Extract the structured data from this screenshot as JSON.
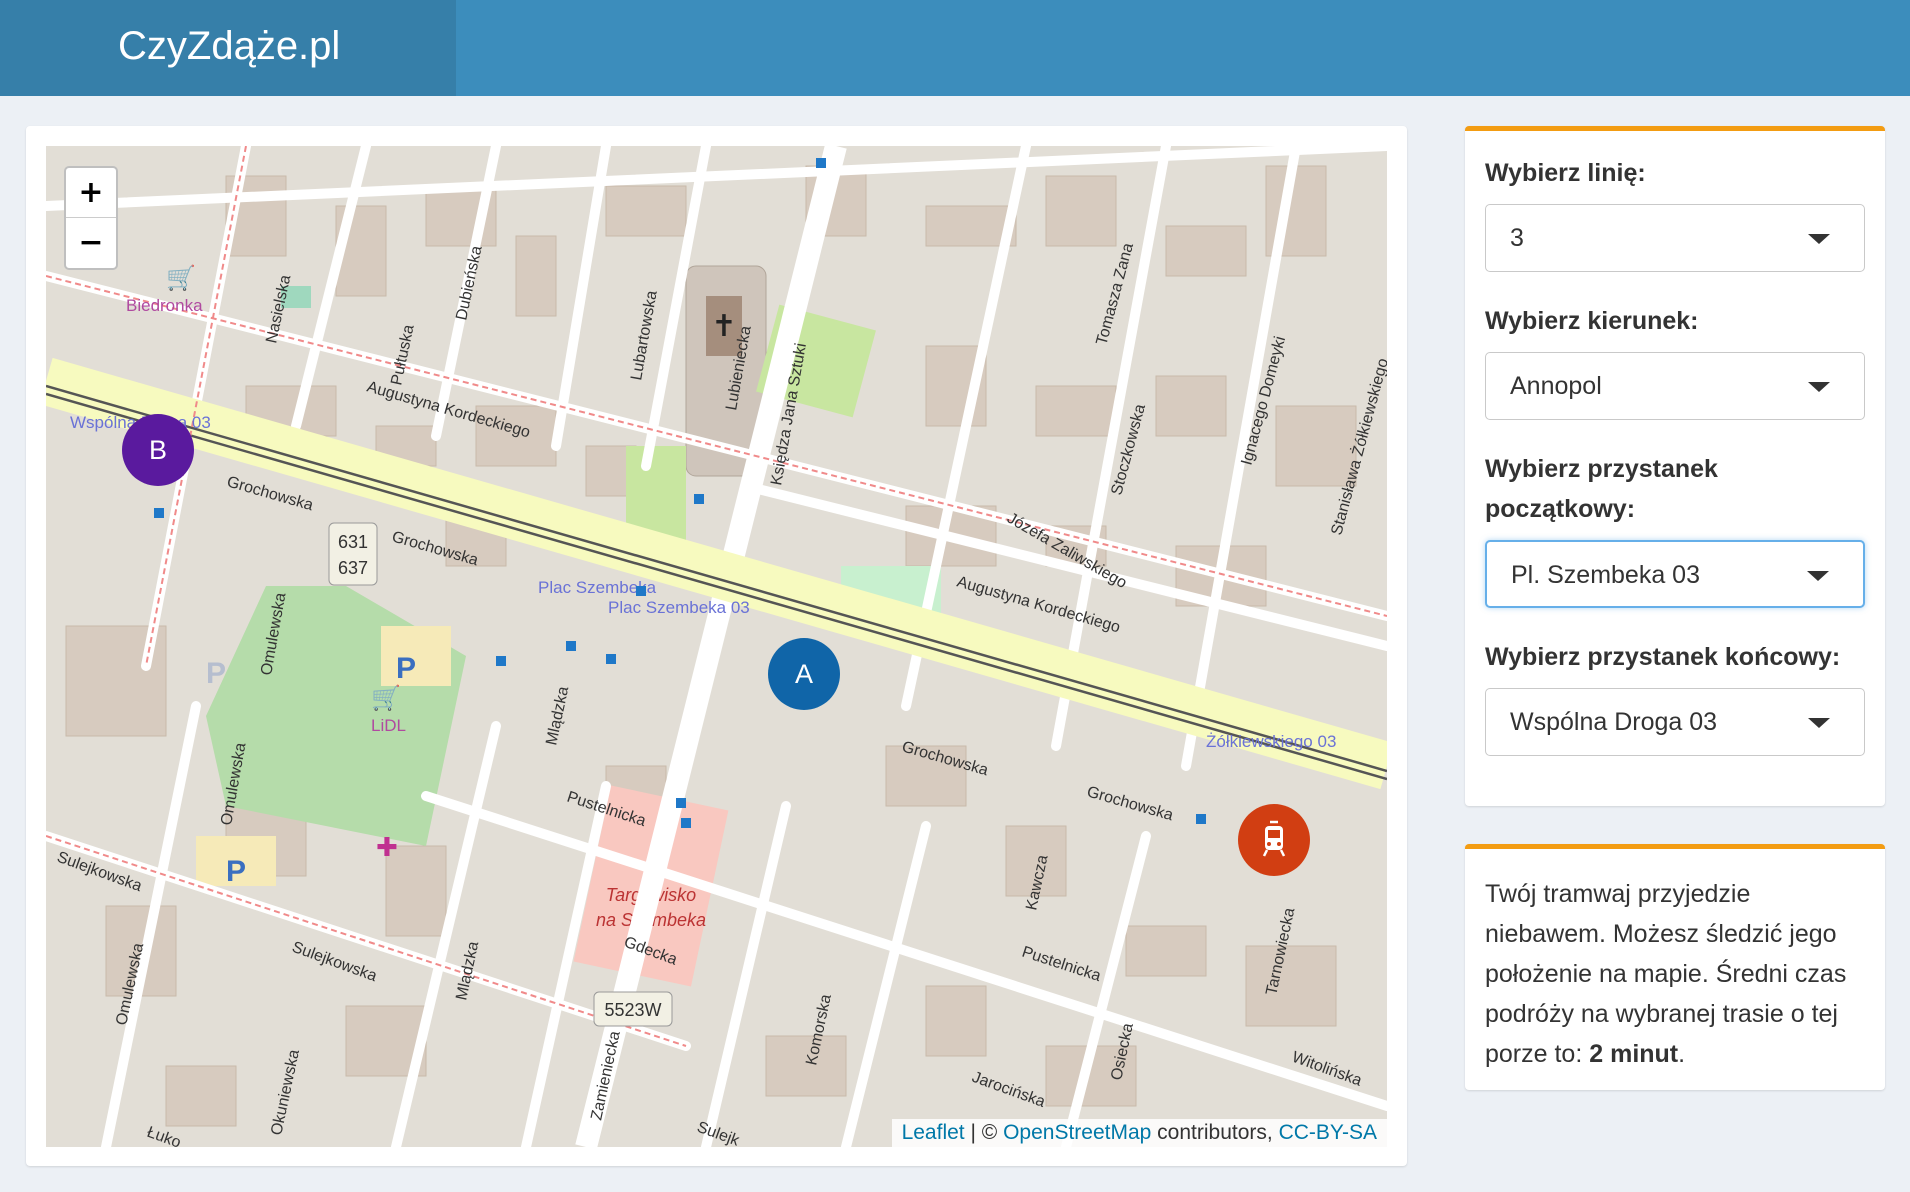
{
  "header": {
    "brand": "CzyZdąże.pl"
  },
  "map": {
    "zoom_in": "+",
    "zoom_out": "−",
    "streets": {
      "grochowska": "Grochowska",
      "augustyna_kordeckiego": "Augustyna Kordeckiego",
      "jozefa_zaliwskiego": "Józefa Zaliwskiego",
      "pultuska": "Pułtuska",
      "dubienska": "Dubieńska",
      "nasielska": "Nasielska",
      "lubartowska": "Lubartowska",
      "lubieniecka": "Lubieniecka",
      "ksiedza_jana_sztuki": "Księdza Jana Sztuki",
      "tomasza_zana": "Tomasza Zana",
      "stoczkowska": "Stoczkowska",
      "ignacego_domeyki": "Ignacego Domeyki",
      "stanislawa_zolkiewskiego": "Stanisława Żółkiewskiego",
      "omulewska": "Omulewska",
      "sulejkowska": "Sulejkowska",
      "pustelnicka": "Pustelnicka",
      "gdecka": "Gdecka",
      "kawcza": "Kawcza",
      "mladzka": "Mlądzka",
      "komorska": "Komorska",
      "jarocinska": "Jarocińska",
      "osiecka": "Osiecka",
      "tarnowiecka": "Tarnowiecka",
      "witolinska": "Witolińska",
      "zamieniecka": "Zamieniecka",
      "okuniewska": "Okuniewska",
      "lukowska": "Łuko",
      "sulejk_short": "Sulejk"
    },
    "places": {
      "biedronka": "Biedronka",
      "lidl": "LiDL",
      "targowisko": "Targowisko na Szembeka",
      "plac_szembeka": "Plac Szembeka"
    },
    "stops": {
      "wspolna_droga": "Wspólna Droga 03",
      "plac_szembeka_03": "Plac Szembeka 03",
      "zolkiewskiego_03": "Żółkiewskiego 03"
    },
    "shields": {
      "route_a": "631",
      "route_b": "637",
      "road": "5523W"
    },
    "marker_b": "B",
    "marker_a": "A",
    "attribution": {
      "leaflet": "Leaflet",
      "sep": " | © ",
      "osm": "OpenStreetMap",
      "contributors": " contributors, ",
      "license": "CC-BY-SA"
    }
  },
  "form": {
    "line_label": "Wybierz linię:",
    "line_value": "3",
    "direction_label": "Wybierz kierunek:",
    "direction_value": "Annopol",
    "start_label": "Wybierz przystanek początkowy:",
    "start_value": "Pl. Szembeka 03",
    "end_label": "Wybierz przystanek końcowy:",
    "end_value": "Wspólna Droga 03"
  },
  "info": {
    "text": "Twój tramwaj przyjedzie niebawem. Możesz śledzić jego położenie na mapie. Średni czas podróży na wybranej trasie o tej porze to: ",
    "duration": "2 minut",
    "end": "."
  },
  "colors": {
    "header": "#3c8dbc",
    "logo_bg": "#367fa9",
    "accent": "#f39c12",
    "marker_b": "#5a1a9e",
    "marker_a": "#1065a8",
    "marker_tram": "#d13e12"
  }
}
